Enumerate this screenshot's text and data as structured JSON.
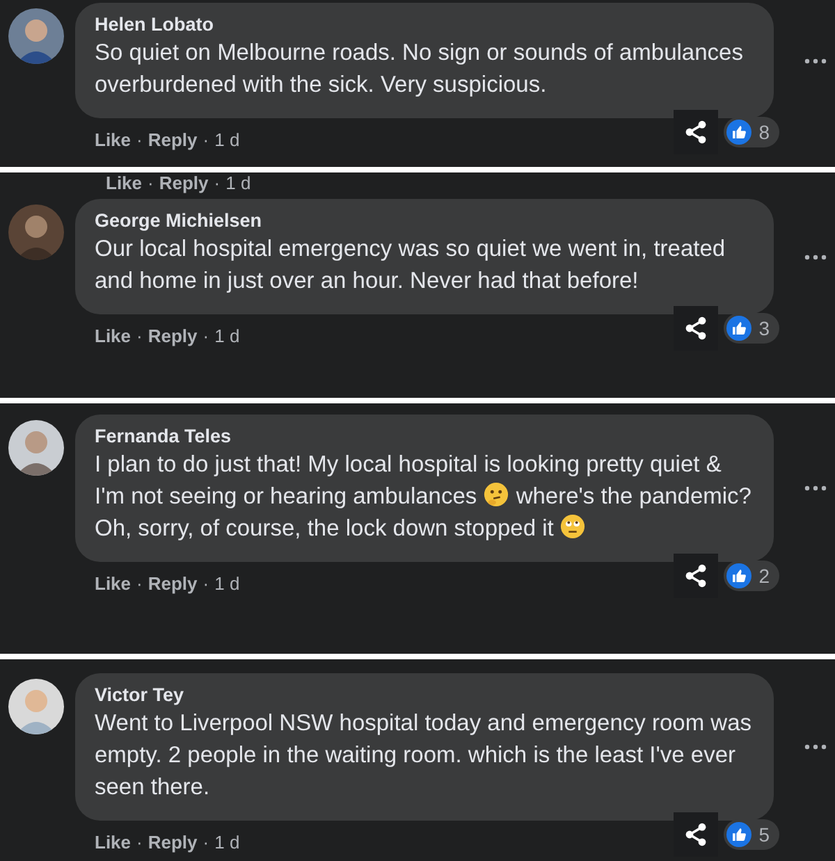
{
  "comments": [
    {
      "author": "Helen Lobato",
      "body": [
        {
          "kind": "text",
          "text": "So quiet on Melbourne roads. No sign or sounds of ambulances overburdened with the sick. Very suspicious."
        }
      ],
      "actions": [
        "Like",
        "Reply"
      ],
      "separator": "·",
      "time": "1 d",
      "reactions": "8"
    },
    {
      "top_clipped": {
        "actions": [
          "Like",
          "Reply"
        ],
        "time": "1 d"
      },
      "author": "George Michielsen",
      "body": [
        {
          "kind": "text",
          "text": "Our local hospital emergency was so quiet we went in, treated and home in just over an hour. Never had that before!"
        }
      ],
      "actions": [
        "Like",
        "Reply"
      ],
      "separator": "·",
      "time": "1 d",
      "reactions": "3"
    },
    {
      "author": "Fernanda Teles",
      "body": [
        {
          "kind": "text",
          "text": "I plan to do just that! My local hospital is looking pretty quiet & I'm not seeing or hearing ambulances "
        },
        {
          "kind": "thinking"
        },
        {
          "kind": "text",
          "text": " where's the pandemic? Oh, sorry, of course, the lock down stopped it "
        },
        {
          "kind": "eyeroll"
        }
      ],
      "actions": [
        "Like",
        "Reply"
      ],
      "separator": "·",
      "time": "1 d",
      "reactions": "2"
    },
    {
      "author": "Victor Tey",
      "body": [
        {
          "kind": "text",
          "text": "Went to Liverpool NSW hospital today and emergency room was empty. 2 people in the waiting room. which is the least I've ever seen there."
        }
      ],
      "actions": [
        "Like",
        "Reply"
      ],
      "separator": "·",
      "time": "1 d",
      "reactions": "5"
    }
  ]
}
